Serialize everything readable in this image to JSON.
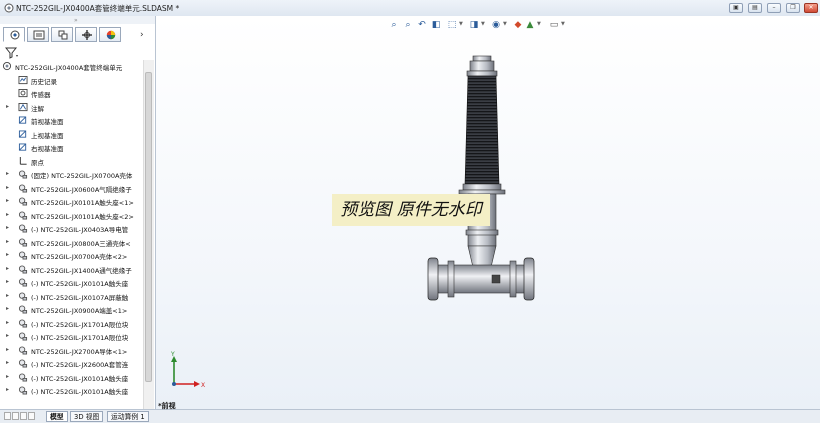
{
  "window": {
    "title": "NTC-252GIL-JX0400A套管终端单元.SLDASM *",
    "controls": [
      "restore",
      "tile",
      "minimize",
      "restore-down",
      "close"
    ]
  },
  "panel": {
    "tabs": [
      "featuremanager",
      "propertymanager",
      "configurationmanager",
      "dimxpert",
      "display-manager"
    ],
    "active_tab": 0,
    "tree": [
      {
        "indent": 0,
        "expandable": false,
        "icon": "assembly-icon",
        "label": "NTC-252GIL-JX0400A套管终端单元"
      },
      {
        "indent": 1,
        "expandable": false,
        "icon": "history-icon",
        "label": "历史记录"
      },
      {
        "indent": 1,
        "expandable": false,
        "icon": "sensor-icon",
        "label": "传感器"
      },
      {
        "indent": 1,
        "expandable": true,
        "icon": "annotation-icon",
        "label": "注解"
      },
      {
        "indent": 1,
        "expandable": false,
        "icon": "plane-icon",
        "label": "前视基准面"
      },
      {
        "indent": 1,
        "expandable": false,
        "icon": "plane-icon",
        "label": "上视基准面"
      },
      {
        "indent": 1,
        "expandable": false,
        "icon": "plane-icon",
        "label": "右视基准面"
      },
      {
        "indent": 1,
        "expandable": false,
        "icon": "origin-icon",
        "label": "原点"
      },
      {
        "indent": 1,
        "expandable": true,
        "icon": "component-icon",
        "label": "(固定) NTC-252GIL-JX0700A壳体"
      },
      {
        "indent": 1,
        "expandable": true,
        "icon": "component-icon",
        "label": "NTC-252GIL-JX0600A气隔绝缘子"
      },
      {
        "indent": 1,
        "expandable": true,
        "icon": "component-icon",
        "label": "NTC-252GIL-JX0101A触头座<1>"
      },
      {
        "indent": 1,
        "expandable": true,
        "icon": "component-icon",
        "label": "NTC-252GIL-JX0101A触头座<2>"
      },
      {
        "indent": 1,
        "expandable": true,
        "icon": "component-icon",
        "label": "(-) NTC-252GIL-JX0403A导电管"
      },
      {
        "indent": 1,
        "expandable": true,
        "icon": "component-icon",
        "label": "NTC-252GIL-JX0800A三通壳体<"
      },
      {
        "indent": 1,
        "expandable": true,
        "icon": "component-icon",
        "label": "NTC-252GIL-JX0700A壳体<2>"
      },
      {
        "indent": 1,
        "expandable": true,
        "icon": "component-icon",
        "label": "NTC-252GIL-JX1400A通气绝缘子"
      },
      {
        "indent": 1,
        "expandable": true,
        "icon": "component-icon",
        "label": "(-) NTC-252GIL-JX0101A触头座"
      },
      {
        "indent": 1,
        "expandable": true,
        "icon": "component-icon",
        "label": "(-) NTC-252GIL-JX0107A屏蔽触"
      },
      {
        "indent": 1,
        "expandable": true,
        "icon": "component-icon",
        "label": "NTC-252GIL-JX0900A端盖<1>"
      },
      {
        "indent": 1,
        "expandable": true,
        "icon": "component-icon",
        "label": "(-) NTC-252GIL-JX1701A限位块"
      },
      {
        "indent": 1,
        "expandable": true,
        "icon": "component-icon",
        "label": "(-) NTC-252GIL-JX1701A限位块"
      },
      {
        "indent": 1,
        "expandable": true,
        "icon": "component-icon",
        "label": "NTC-252GIL-JX2700A导体<1>"
      },
      {
        "indent": 1,
        "expandable": true,
        "icon": "component-icon",
        "label": "(-) NTC-252GIL-JX2600A套管连"
      },
      {
        "indent": 1,
        "expandable": true,
        "icon": "component-icon",
        "label": "(-) NTC-252GIL-JX0101A触头座"
      },
      {
        "indent": 1,
        "expandable": true,
        "icon": "component-icon",
        "label": "(-) NTC-252GIL-JX0101A触头座"
      }
    ]
  },
  "bottom_tabs": [
    {
      "label": "模型",
      "active": true
    },
    {
      "label": "3D 视图",
      "active": false
    },
    {
      "label": "运动算例 1",
      "active": false
    }
  ],
  "viewport": {
    "watermark": "预览图 原件无水印",
    "view_name": "*前视",
    "axes": {
      "x": "X",
      "y": "Y"
    },
    "hud_tools": [
      "zoom-to-fit-icon",
      "zoom-area-icon",
      "previous-view-icon",
      "section-view-icon",
      "view-orientation-icon",
      "display-style-icon",
      "hide-show-icon",
      "edit-appearance-icon",
      "scene-icon",
      "view-settings-icon"
    ]
  },
  "colors": {
    "accent": "#2b5c9a",
    "watermark_bg": "#f4efc6",
    "model_dark": "#2a2a2a",
    "model_metal": "#c9ccd4"
  }
}
